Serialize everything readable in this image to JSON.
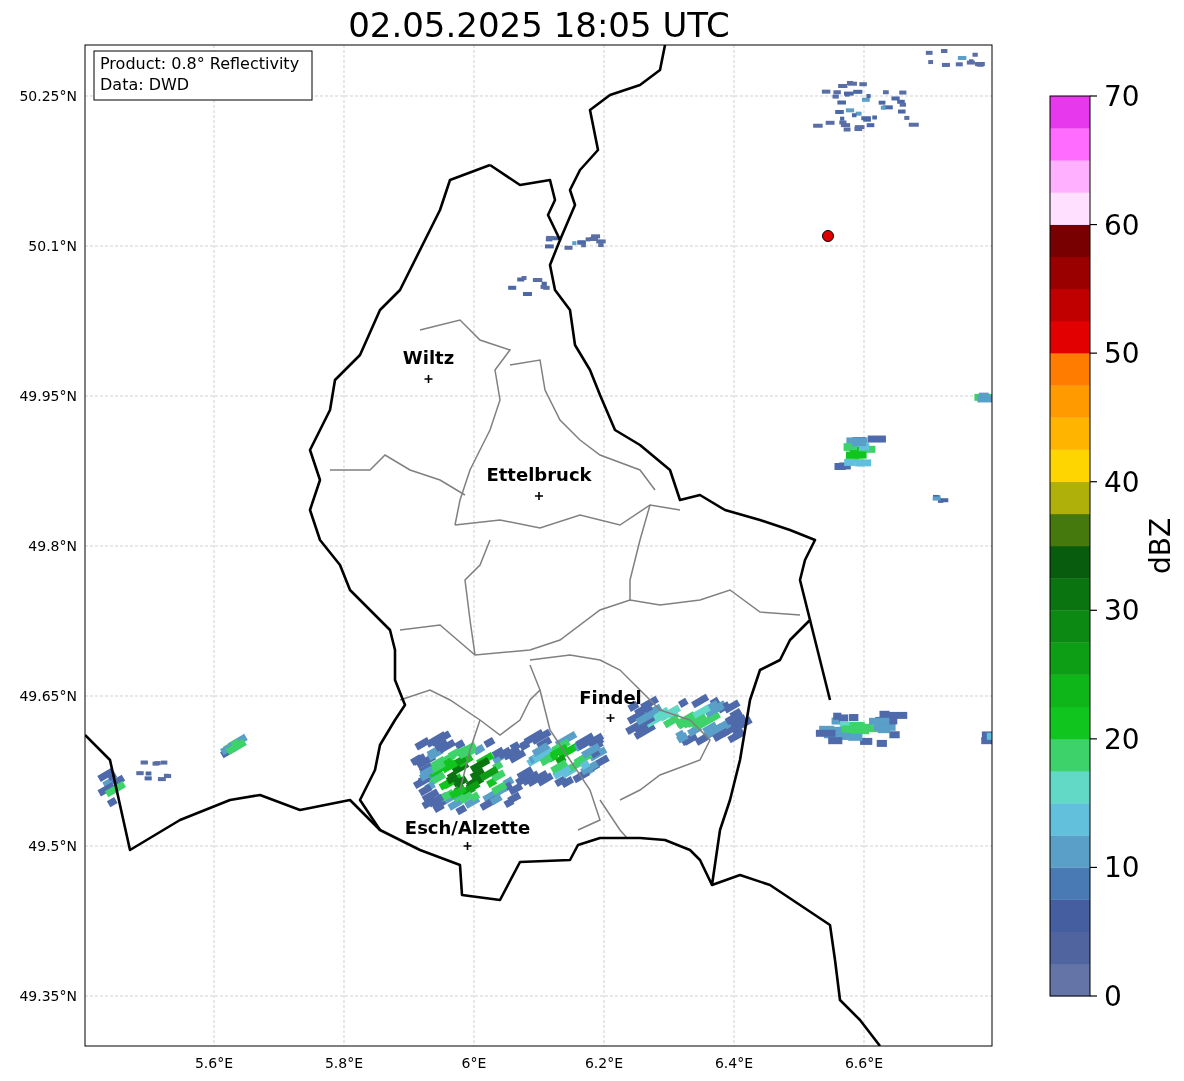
{
  "title": "02.05.2025 18:05 UTC",
  "info": [
    "Product: 0.8° Reflectivity",
    "Data: DWD"
  ],
  "lat_ticks": [
    "50.25°N",
    "50.1°N",
    "49.95°N",
    "49.8°N",
    "49.65°N",
    "49.5°N",
    "49.35°N"
  ],
  "lon_ticks": [
    "5.6°E",
    "5.8°E",
    "6°E",
    "6.2°E",
    "6.4°E",
    "6.6°E"
  ],
  "cities": [
    {
      "name": "Wiltz"
    },
    {
      "name": "Ettelbruck"
    },
    {
      "name": "Findel"
    },
    {
      "name": "Esch/Alzette"
    }
  ],
  "colorbar": {
    "label": "dBZ",
    "ticks": [
      "70",
      "60",
      "50",
      "40",
      "30",
      "20",
      "10",
      "0"
    ],
    "segments": [
      {
        "color": "#6474a6"
      },
      {
        "color": "#5065a0"
      },
      {
        "color": "#445ea0"
      },
      {
        "color": "#4a7ab3"
      },
      {
        "color": "#5a9fc8"
      },
      {
        "color": "#62c0dc"
      },
      {
        "color": "#62d9c6"
      },
      {
        "color": "#3dd36a"
      },
      {
        "color": "#10c61e"
      },
      {
        "color": "#0fb61a"
      },
      {
        "color": "#0e9e16"
      },
      {
        "color": "#0c8913"
      },
      {
        "color": "#0a7510"
      },
      {
        "color": "#075d0d"
      },
      {
        "color": "#45790e"
      },
      {
        "color": "#b0b00a"
      },
      {
        "color": "#ffd500"
      },
      {
        "color": "#ffb400"
      },
      {
        "color": "#ff9a00"
      },
      {
        "color": "#ff7c00"
      },
      {
        "color": "#e20000"
      },
      {
        "color": "#c00000"
      },
      {
        "color": "#9a0000"
      },
      {
        "color": "#780000"
      },
      {
        "color": "#ffe0ff"
      },
      {
        "color": "#ffb0ff"
      },
      {
        "color": "#ff6cff"
      },
      {
        "color": "#e838ee"
      }
    ]
  }
}
